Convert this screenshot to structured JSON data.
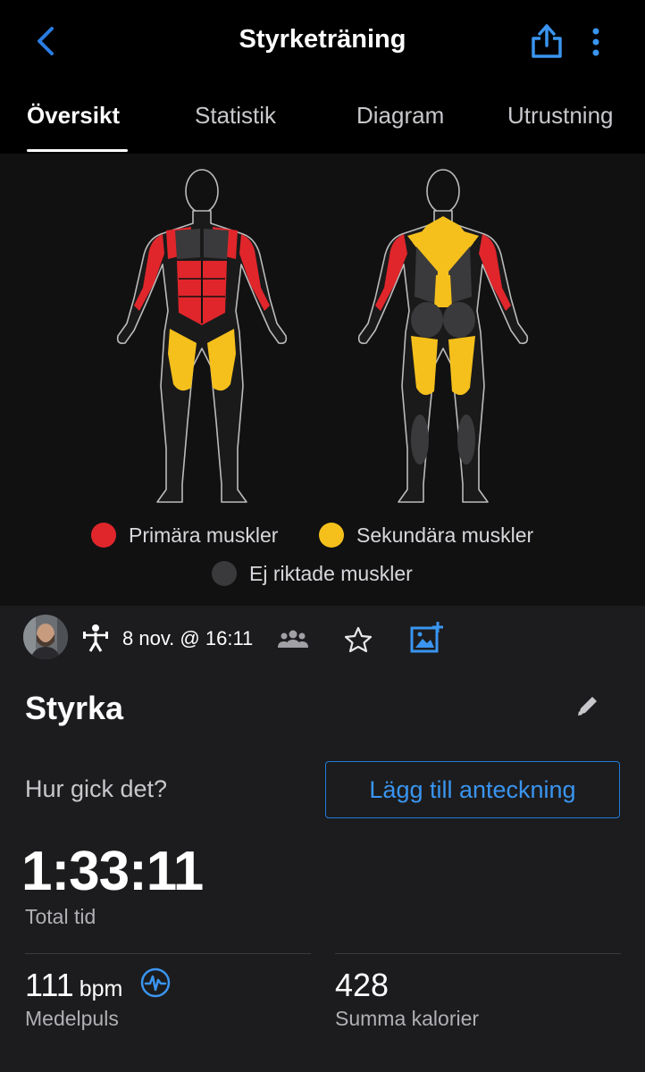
{
  "header": {
    "title": "Styrketräning",
    "back_icon": "chevron-left-icon",
    "share_icon": "share-icon",
    "more_icon": "more-vertical-icon"
  },
  "tabs": [
    {
      "label": "Översikt",
      "active": true
    },
    {
      "label": "Statistik",
      "active": false
    },
    {
      "label": "Diagram",
      "active": false
    },
    {
      "label": "Utrustning",
      "active": false
    }
  ],
  "muscle_map": {
    "legend": [
      {
        "label": "Primära muskler",
        "color": "#e0262b"
      },
      {
        "label": "Sekundära muskler",
        "color": "#f5c01c"
      },
      {
        "label": "Ej riktade muskler",
        "color": "#3a3a3c"
      }
    ]
  },
  "activity": {
    "date": "8 nov. @ 16:11",
    "name": "Styrka",
    "prompt": "Hur gick det?",
    "add_note_label": "Lägg till anteckning"
  },
  "stats": {
    "total_time": {
      "value": "1:33:11",
      "label": "Total tid"
    },
    "avg_hr": {
      "value": "111",
      "unit": "bpm",
      "label": "Medelpuls"
    },
    "calories": {
      "value": "428",
      "label": "Summa kalorier"
    }
  },
  "colors": {
    "accent": "#1f7ad8",
    "primary_muscle": "#e0262b",
    "secondary_muscle": "#f5c01c",
    "untargeted": "#3a3a3c"
  }
}
